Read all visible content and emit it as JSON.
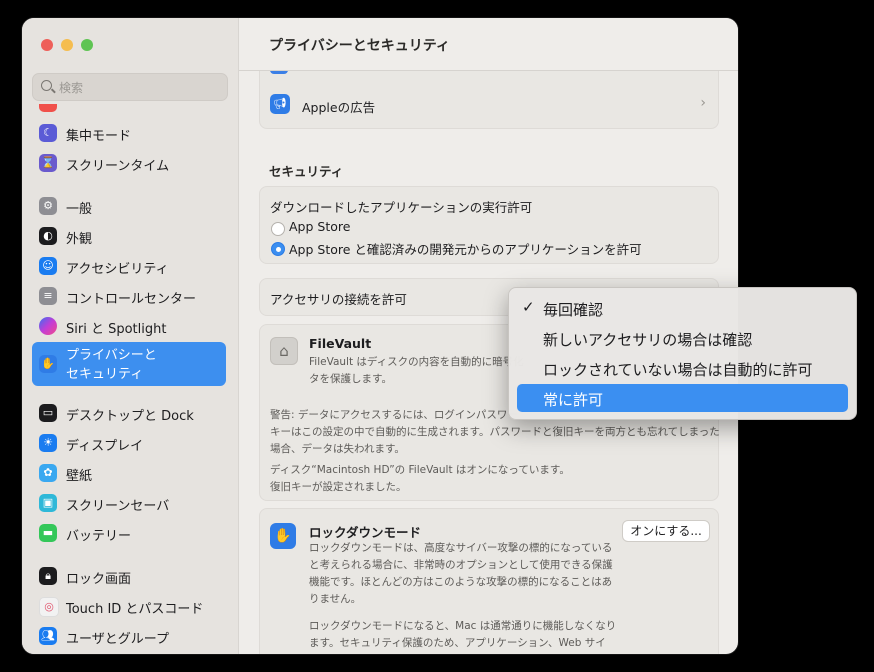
{
  "window": {
    "title": "プライバシーとセキュリティ"
  },
  "sidebar": {
    "search_placeholder": "検索",
    "items": [
      {
        "label": "集中モード",
        "icon": "moon-icon",
        "color": "#5b5bd6"
      },
      {
        "label": "スクリーンタイム",
        "icon": "hourglass-icon",
        "color": "#6a5acd"
      },
      {
        "label": "一般",
        "icon": "gear-icon",
        "color": "#8e8e93"
      },
      {
        "label": "外観",
        "icon": "appearance-icon",
        "color": "#1c1c1e"
      },
      {
        "label": "アクセシビリティ",
        "icon": "accessibility-icon",
        "color": "#1a7cf0"
      },
      {
        "label": "コントロールセンター",
        "icon": "control-center-icon",
        "color": "#8e8e93"
      },
      {
        "label": "Siri と Spotlight",
        "icon": "siri-icon",
        "color": "#c33dd6"
      },
      {
        "label": "プライバシーと\nセキュリティ",
        "icon": "hand-icon",
        "color": "#2f7ce6",
        "selected": true
      },
      {
        "label": "デスクトップと Dock",
        "icon": "dock-icon",
        "color": "#1c1c1e"
      },
      {
        "label": "ディスプレイ",
        "icon": "display-icon",
        "color": "#1a7cf0"
      },
      {
        "label": "壁紙",
        "icon": "wallpaper-icon",
        "color": "#3aa8f0"
      },
      {
        "label": "スクリーンセーバ",
        "icon": "screensaver-icon",
        "color": "#2fb8d8"
      },
      {
        "label": "バッテリー",
        "icon": "battery-icon",
        "color": "#34c759"
      },
      {
        "label": "ロック画面",
        "icon": "lock-icon",
        "color": "#1c1c1e"
      },
      {
        "label": "Touch ID とパスコード",
        "icon": "fingerprint-icon",
        "color": "#f2f2f2"
      },
      {
        "label": "ユーザとグループ",
        "icon": "users-icon",
        "color": "#1a7cf0"
      }
    ]
  },
  "main": {
    "apple_ads": {
      "label": "Appleの広告"
    },
    "security": {
      "heading": "セキュリティ",
      "download_title": "ダウンロードしたアプリケーションの実行許可",
      "options": [
        {
          "label": "App Store",
          "selected": false
        },
        {
          "label": "App Store と確認済みの開発元からのアプリケーションを許可",
          "selected": true
        }
      ],
      "accessory_label": "アクセサリの接続を許可"
    },
    "filevault": {
      "title": "FileVault",
      "desc": "FileVault はディスクの内容を自動的に暗号化",
      "desc2": "タを保護します。",
      "warning": "警告: データにアクセスするには、ログインパスワー",
      "warning2": "キーはこの設定の中で自動的に生成されます。パスワードと復旧キーを両方とも忘れてしまった",
      "warning3": "場合、データは失われます。",
      "status": "ディスク“Macintosh HD”の FileVault はオンになっています。",
      "status2": "復旧キーが設定されました。"
    },
    "lockdown": {
      "title": "ロックダウンモード",
      "button": "オンにする...",
      "desc": "ロックダウンモードは、高度なサイバー攻撃の標的になっている",
      "desc2": "と考えられる場合に、非常時のオプションとして使用できる保護",
      "desc3": "機能です。ほとんどの方はこのような攻撃の標的になることはあ",
      "desc4": "りません。",
      "desc5": "ロックダウンモードになると、Mac は通常通りに機能しなくなり",
      "desc6": "ます。セキュリティ保護のため、アプリケーション、Web サイ"
    }
  },
  "popup_menu": {
    "items": [
      {
        "label": "毎回確認",
        "checked": true
      },
      {
        "label": "新しいアクセサリの場合は確認",
        "checked": false
      },
      {
        "label": "ロックされていない場合は自動的に許可",
        "checked": false
      },
      {
        "label": "常に許可",
        "checked": false,
        "highlighted": true
      }
    ]
  }
}
